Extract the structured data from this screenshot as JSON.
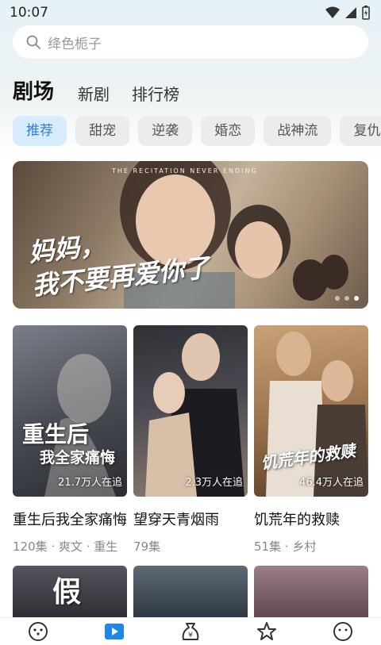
{
  "status_bar": {
    "time": "10:07"
  },
  "search": {
    "placeholder": "绛色栀子"
  },
  "top_tabs": [
    {
      "label": "剧场",
      "active": true
    },
    {
      "label": "新剧",
      "active": false
    },
    {
      "label": "排行榜",
      "active": false
    }
  ],
  "chips": [
    {
      "label": "推荐",
      "active": true
    },
    {
      "label": "甜宠",
      "active": false
    },
    {
      "label": "逆袭",
      "active": false
    },
    {
      "label": "婚恋",
      "active": false
    },
    {
      "label": "战神流",
      "active": false
    },
    {
      "label": "复仇",
      "active": false
    }
  ],
  "banner": {
    "subtitle": "THE RECITATION NEVER ENDING",
    "caption_line1": "妈妈，",
    "caption_line2": "我不要再爱你了",
    "slide_count": 3,
    "active_slide": 3
  },
  "cards": [
    {
      "title": "重生后我全家痛悔",
      "views": "21.7万人在追",
      "meta": "120集 · 爽文 · 重生",
      "art_text_1": "重生后",
      "art_text_2": "我全家痛悔",
      "color_a": "#6b6f78",
      "color_b": "#2f3136"
    },
    {
      "title": "望穿天青烟雨",
      "views": "2.3万人在追",
      "meta": "79集",
      "art_text_1": "",
      "art_text_2": "",
      "color_a": "#3a3a40",
      "color_b": "#8a7a6f"
    },
    {
      "title": "饥荒年的救赎",
      "views": "46.4万人在追",
      "meta": "51集 · 乡村",
      "art_text_1": "饥荒年的救赎",
      "art_text_2": "",
      "color_a": "#b58a5a",
      "color_b": "#5a3f28"
    }
  ],
  "row2_colors": [
    "#3c3c44",
    "#4a5560",
    "#8a6f7a"
  ],
  "colors": {
    "accent": "#2f7dd8",
    "chip_active_bg": "#d9ecff",
    "chip_bg": "#ececec",
    "nav_active": "#1e88e5"
  },
  "bottom_nav": [
    {
      "icon": "game-controller-icon",
      "active": false
    },
    {
      "icon": "play-icon",
      "active": true
    },
    {
      "icon": "money-bag-icon",
      "active": false
    },
    {
      "icon": "star-icon",
      "active": false
    },
    {
      "icon": "smiley-icon",
      "active": false
    }
  ]
}
